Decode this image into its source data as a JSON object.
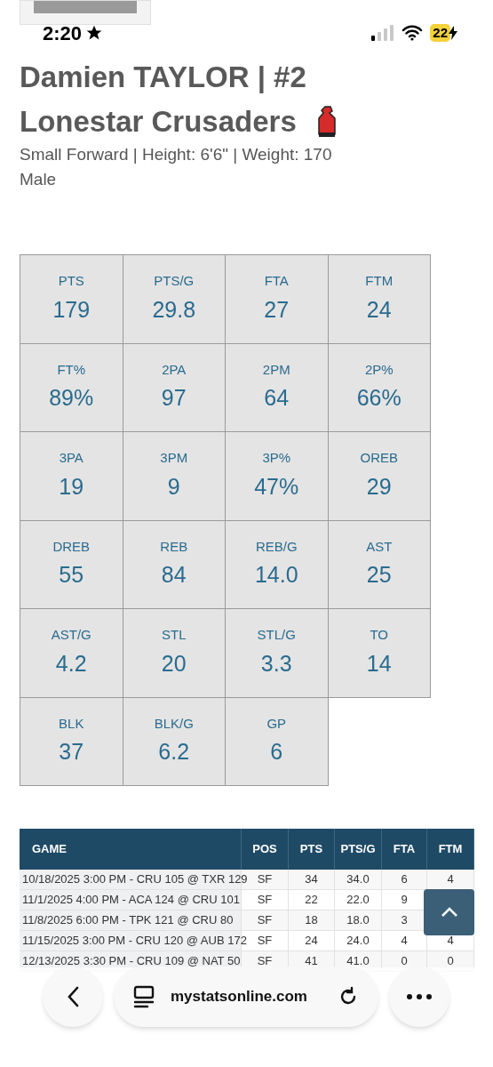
{
  "status_bar": {
    "time": "2:20",
    "battery": "22"
  },
  "player": {
    "name": "Damien TAYLOR | #2",
    "team": "Lonestar Crusaders",
    "details": "Small Forward | Height: 6'6\" | Weight: 170",
    "gender": "Male"
  },
  "stats": [
    {
      "label": "PTS",
      "value": "179"
    },
    {
      "label": "PTS/G",
      "value": "29.8"
    },
    {
      "label": "FTA",
      "value": "27"
    },
    {
      "label": "FTM",
      "value": "24"
    },
    {
      "label": "FT%",
      "value": "89%"
    },
    {
      "label": "2PA",
      "value": "97"
    },
    {
      "label": "2PM",
      "value": "64"
    },
    {
      "label": "2P%",
      "value": "66%"
    },
    {
      "label": "3PA",
      "value": "19"
    },
    {
      "label": "3PM",
      "value": "9"
    },
    {
      "label": "3P%",
      "value": "47%"
    },
    {
      "label": "OREB",
      "value": "29"
    },
    {
      "label": "DREB",
      "value": "55"
    },
    {
      "label": "REB",
      "value": "84"
    },
    {
      "label": "REB/G",
      "value": "14.0"
    },
    {
      "label": "AST",
      "value": "25"
    },
    {
      "label": "AST/G",
      "value": "4.2"
    },
    {
      "label": "STL",
      "value": "20"
    },
    {
      "label": "STL/G",
      "value": "3.3"
    },
    {
      "label": "TO",
      "value": "14"
    },
    {
      "label": "BLK",
      "value": "37"
    },
    {
      "label": "BLK/G",
      "value": "6.2"
    },
    {
      "label": "GP",
      "value": "6"
    }
  ],
  "table": {
    "columns": [
      "GAME",
      "POS",
      "PTS",
      "PTS/G",
      "FTA",
      "FTM"
    ],
    "rows": [
      [
        "10/18/2025 3:00 PM - CRU 105 @ TXR 129",
        "SF",
        "34",
        "34.0",
        "6",
        "4"
      ],
      [
        "11/1/2025 4:00 PM - ACA 124 @ CRU 101",
        "SF",
        "22",
        "22.0",
        "9",
        ""
      ],
      [
        "11/8/2025 6:00 PM - TPK 121 @ CRU 80",
        "SF",
        "18",
        "18.0",
        "3",
        ""
      ],
      [
        "11/15/2025 3:00 PM - CRU 120 @ AUB 172",
        "SF",
        "24",
        "24.0",
        "4",
        "4"
      ],
      [
        "12/13/2025 3:30 PM - CRU 109 @ NAT 50",
        "SF",
        "41",
        "41.0",
        "0",
        "0"
      ]
    ]
  },
  "browser": {
    "url": "mystatsonline.com"
  }
}
